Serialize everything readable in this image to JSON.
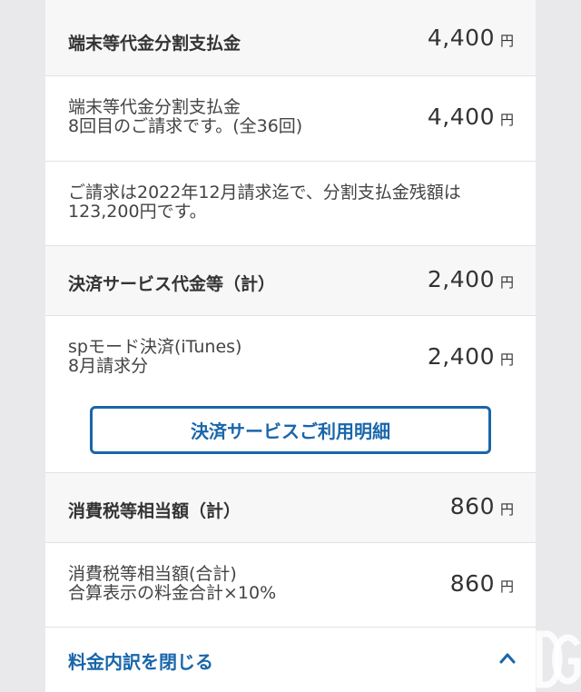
{
  "rows": [
    {
      "label": "端末等代金分割支払金",
      "amount": "4,400",
      "unit": "円"
    },
    {
      "label": "端末等代金分割支払金\n8回目のご請求です。(全36回)",
      "amount": "4,400",
      "unit": "円"
    },
    {
      "note": "ご請求は2022年12月請求迄で、分割支払金残額は\n123,200円です。"
    },
    {
      "label": "決済サービス代金等（計）",
      "amount": "2,400",
      "unit": "円"
    },
    {
      "label": "spモード決済(iTunes)\n8月請求分",
      "amount": "2,400",
      "unit": "円"
    },
    {
      "label": "消費税等相当額（計）",
      "amount": "860",
      "unit": "円"
    },
    {
      "label": "消費税等相当額(合計)\n合算表示の料金合計×10%",
      "amount": "860",
      "unit": "円"
    }
  ],
  "button": {
    "label": "決済サービスご利用明細"
  },
  "footer": {
    "close_label": "料金内訳を閉じる",
    "chevron_icon": "chevron-up-icon"
  },
  "watermark": {
    "text": "DG"
  },
  "colors": {
    "accent": "#1966ab",
    "header_bg": "#f7f7f7",
    "page_bg": "#e9e9eb"
  }
}
